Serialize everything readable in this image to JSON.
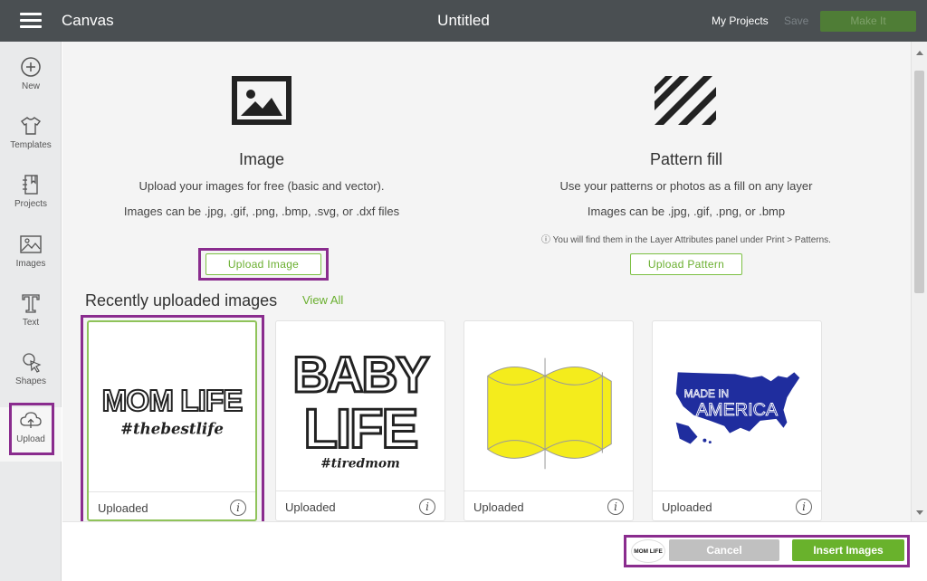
{
  "topbar": {
    "app_title": "Canvas",
    "doc_title": "Untitled",
    "my_projects": "My Projects",
    "save": "Save",
    "make_it": "Make It"
  },
  "sidebar": {
    "items": [
      {
        "label": "New",
        "icon": "plus-circle-icon"
      },
      {
        "label": "Templates",
        "icon": "shirt-icon"
      },
      {
        "label": "Projects",
        "icon": "projects-icon"
      },
      {
        "label": "Images",
        "icon": "image-icon"
      },
      {
        "label": "Text",
        "icon": "text-icon"
      },
      {
        "label": "Shapes",
        "icon": "shapes-icon"
      },
      {
        "label": "Upload",
        "icon": "cloud-upload-icon"
      }
    ],
    "active": "Upload"
  },
  "image_section": {
    "title": "Image",
    "line1": "Upload your images for free (basic and vector).",
    "line2": "Images can be .jpg, .gif, .png, .bmp, .svg, or .dxf files",
    "button": "Upload Image"
  },
  "pattern_section": {
    "title": "Pattern fill",
    "line1": "Use your patterns or photos as a fill on any layer",
    "line2": "Images can be .jpg, .gif, .png, or .bmp",
    "note": "ⓘ You will find them in the Layer Attributes panel under Print > Patterns.",
    "button": "Upload Pattern"
  },
  "recent": {
    "title": "Recently uploaded images",
    "view_all": "View All",
    "cards": [
      {
        "label": "Uploaded",
        "line1": "MOM LIFE",
        "line2": "#thebestlife",
        "selected": true
      },
      {
        "label": "Uploaded",
        "line1": "BABY",
        "line2": "LIFE",
        "line3": "#tiredmom"
      },
      {
        "label": "Uploaded"
      },
      {
        "label": "Uploaded",
        "line1": "MADE IN",
        "line2": "AMERICA"
      }
    ]
  },
  "bottom": {
    "mini_thumb": "MOM LIFE",
    "cancel": "Cancel",
    "insert": "Insert Images"
  },
  "colors": {
    "topbar": "#4a4f52",
    "accent_green": "#69b22c",
    "highlight_purple": "#8a2c8e",
    "usa_blue": "#1f2d9e",
    "shape_yellow": "#f4ec1c"
  }
}
